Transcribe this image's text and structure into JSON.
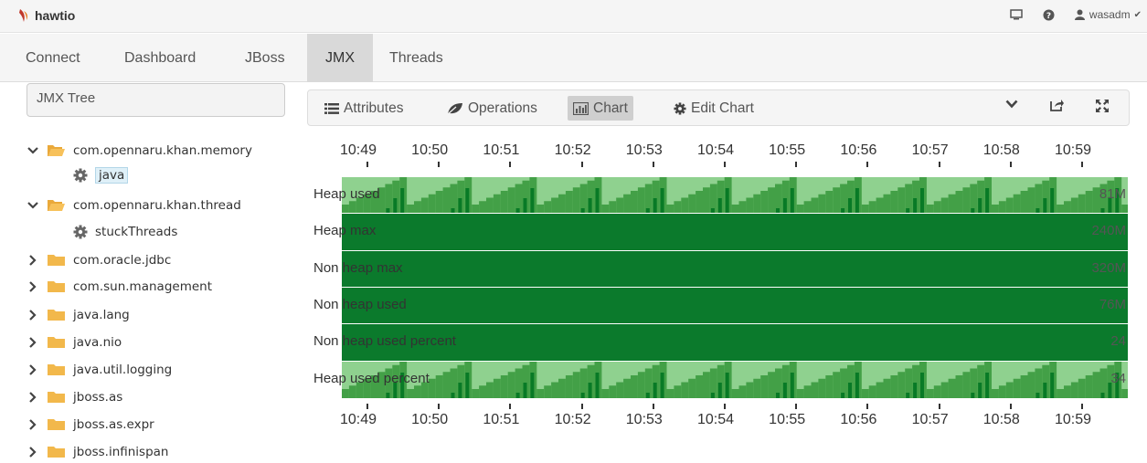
{
  "app": {
    "brand": "hawtio"
  },
  "topbar": {
    "user": "wasadm"
  },
  "nav": {
    "tabs": [
      {
        "label": "Connect",
        "active": false
      },
      {
        "label": "Dashboard",
        "active": false
      },
      {
        "label": "JBoss",
        "active": false
      },
      {
        "label": "JMX",
        "active": true
      },
      {
        "label": "Threads",
        "active": false
      }
    ]
  },
  "left": {
    "search_value": "JMX Tree",
    "tree": [
      {
        "label": "com.opennaru.khan.memory",
        "type": "folder",
        "expanded": true
      },
      {
        "label": "java",
        "type": "mbean",
        "selected": true
      },
      {
        "label": "com.opennaru.khan.thread",
        "type": "folder",
        "expanded": true
      },
      {
        "label": "stuckThreads",
        "type": "mbean"
      },
      {
        "label": "com.oracle.jdbc",
        "type": "folder",
        "expanded": false
      },
      {
        "label": "com.sun.management",
        "type": "folder",
        "expanded": false
      },
      {
        "label": "java.lang",
        "type": "folder",
        "expanded": false
      },
      {
        "label": "java.nio",
        "type": "folder",
        "expanded": false
      },
      {
        "label": "java.util.logging",
        "type": "folder",
        "expanded": false
      },
      {
        "label": "jboss.as",
        "type": "folder",
        "expanded": false
      },
      {
        "label": "jboss.as.expr",
        "type": "folder",
        "expanded": false
      },
      {
        "label": "jboss.infinispan",
        "type": "folder",
        "expanded": false
      }
    ]
  },
  "toolbar": {
    "attributes": "Attributes",
    "operations": "Operations",
    "chart": "Chart",
    "edit_chart": "Edit Chart"
  },
  "chart_data": {
    "type": "horizon",
    "time_ticks": [
      "10:49",
      "10:50",
      "10:51",
      "10:52",
      "10:53",
      "10:54",
      "10:55",
      "10:56",
      "10:57",
      "10:58",
      "10:59"
    ],
    "series": [
      {
        "name": "Heap used",
        "value": "81M",
        "level": 0.35
      },
      {
        "name": "Heap max",
        "value": "240M",
        "level": 1.0
      },
      {
        "name": "Non heap max",
        "value": "320M",
        "level": 1.0
      },
      {
        "name": "Non heap used",
        "value": "76M",
        "level": 1.0
      },
      {
        "name": "Non heap used percent",
        "value": "24",
        "level": 1.0
      },
      {
        "name": "Heap used percent",
        "value": "34",
        "level": 0.35
      }
    ]
  },
  "colors": {
    "band_light": "#8fd18f",
    "band_mid": "#43a047",
    "band_dark": "#087a26",
    "band_full": "#0b7a2c"
  }
}
